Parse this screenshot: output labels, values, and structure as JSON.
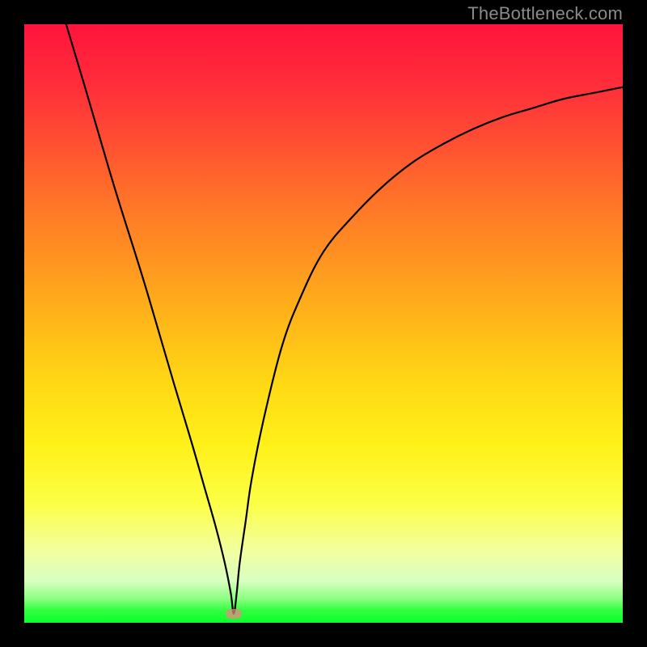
{
  "watermark": "TheBottleneck.com",
  "colors": {
    "frame": "#000000",
    "curve": "#000000",
    "marker": "#e68a7f",
    "watermark": "#8a8a8a"
  },
  "chart_data": {
    "type": "line",
    "title": "",
    "xlabel": "",
    "ylabel": "",
    "xlim": [
      0,
      100
    ],
    "ylim": [
      0,
      100
    ],
    "grid": false,
    "legend": false,
    "series": [
      {
        "name": "bottleneck-curve",
        "x": [
          7,
          10,
          15,
          20,
          25,
          28,
          30,
          32,
          33.5,
          34.5,
          35,
          35.5,
          36,
          37,
          38,
          40,
          43,
          46,
          50,
          55,
          60,
          65,
          70,
          75,
          80,
          85,
          90,
          95,
          100
        ],
        "y": [
          100,
          90,
          73,
          57,
          40,
          30,
          23,
          16,
          10,
          5,
          1.5,
          5,
          10,
          17,
          24,
          34,
          46,
          54,
          62,
          68,
          73,
          77,
          80,
          82.5,
          84.5,
          86,
          87.5,
          88.5,
          89.5
        ]
      }
    ],
    "annotations": [
      {
        "name": "bottleneck-marker",
        "x": 35,
        "y": 1.5
      }
    ],
    "background_gradient": {
      "direction": "vertical",
      "stops": [
        {
          "pos": 0.0,
          "color": "#ff143c"
        },
        {
          "pos": 0.5,
          "color": "#ffb818"
        },
        {
          "pos": 0.8,
          "color": "#fcff45"
        },
        {
          "pos": 1.0,
          "color": "#0aff2c"
        }
      ]
    }
  }
}
